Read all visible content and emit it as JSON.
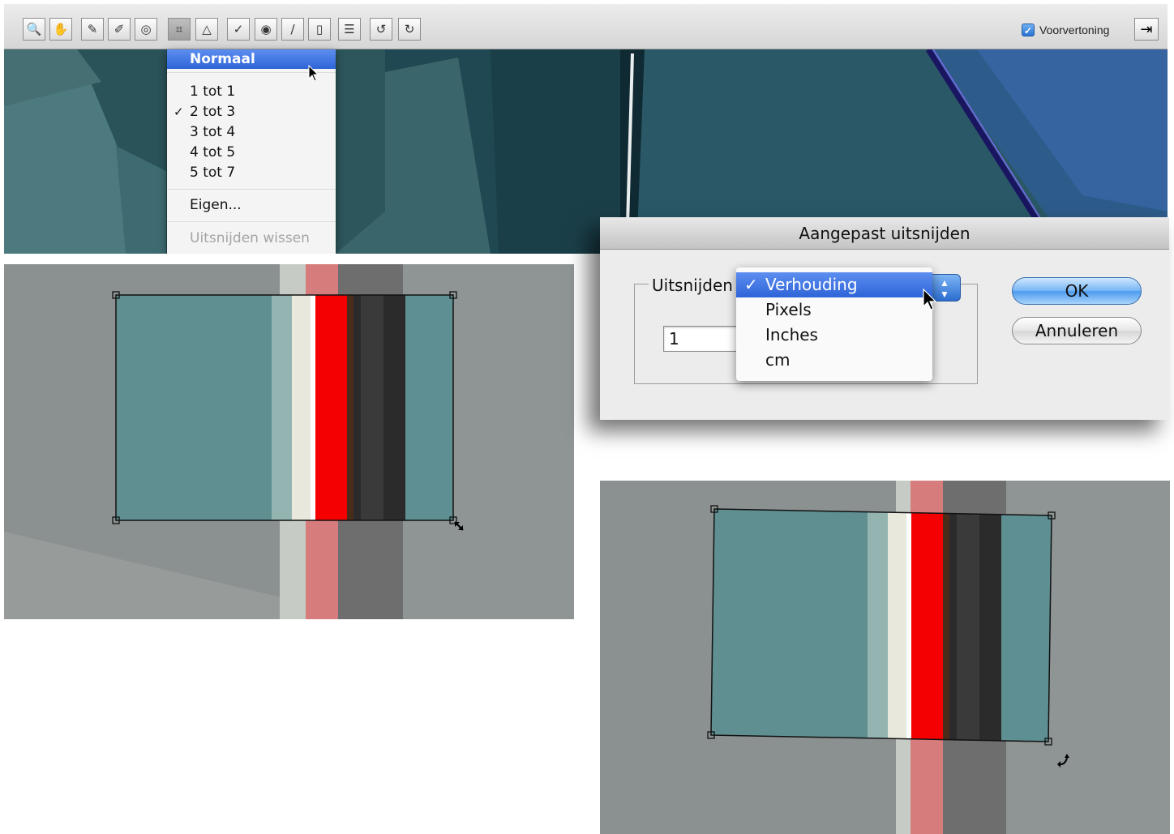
{
  "toolbar": {
    "tools": [
      {
        "name": "zoom-tool",
        "icon": "magnifier-icon",
        "glyph": "🔍"
      },
      {
        "name": "hand-tool",
        "icon": "hand-icon",
        "glyph": "✋"
      },
      {
        "name": "white-balance-tool",
        "icon": "eyedropper-icon",
        "glyph": "✎"
      },
      {
        "name": "color-sampler-tool",
        "icon": "color-sampler-icon",
        "glyph": "✐"
      },
      {
        "name": "target-adjustment-tool",
        "icon": "target-adjustment-icon",
        "glyph": "◎"
      },
      {
        "name": "crop-tool",
        "icon": "crop-icon",
        "glyph": "⌗",
        "active": true
      },
      {
        "name": "straighten-tool",
        "icon": "straighten-icon",
        "glyph": "△"
      },
      {
        "name": "spot-removal-tool",
        "icon": "spot-removal-icon",
        "glyph": "✓"
      },
      {
        "name": "red-eye-tool",
        "icon": "red-eye-icon",
        "glyph": "◉"
      },
      {
        "name": "adjustment-brush-tool",
        "icon": "brush-icon",
        "glyph": "/"
      },
      {
        "name": "graduated-filter-tool",
        "icon": "graduated-filter-icon",
        "glyph": "▯"
      },
      {
        "name": "preferences-tool",
        "icon": "list-icon",
        "glyph": "☰"
      },
      {
        "name": "rotate-left-tool",
        "icon": "rotate-left-icon",
        "glyph": "↺"
      },
      {
        "name": "rotate-right-tool",
        "icon": "rotate-right-icon",
        "glyph": "↻"
      }
    ],
    "preview_checked": true,
    "preview_label": "Voorvertoning",
    "fullscreen_icon": "fullscreen-icon"
  },
  "crop_menu": {
    "highlighted": "Normaal",
    "ratio_items": [
      {
        "label": "1 tot 1",
        "checked": false
      },
      {
        "label": "2 tot 3",
        "checked": true
      },
      {
        "label": "3 tot 4",
        "checked": false
      },
      {
        "label": "4 tot 5",
        "checked": false
      },
      {
        "label": "5 tot 7",
        "checked": false
      }
    ],
    "custom": "Eigen...",
    "clear": "Uitsnijden wissen"
  },
  "dialog": {
    "title": "Aangepast uitsnijden",
    "group_label": "Uitsnijden",
    "ratio_value": "1",
    "unit_options": [
      {
        "label": "Verhouding",
        "checked": true
      },
      {
        "label": "Pixels",
        "checked": false
      },
      {
        "label": "Inches",
        "checked": false
      },
      {
        "label": "cm",
        "checked": false
      }
    ],
    "ok_label": "OK",
    "cancel_label": "Annuleren"
  },
  "colors": {
    "photo_teal": "#5f8f92",
    "photo_dark_teal": "#1e4750",
    "photo_gray": "#8e9493",
    "clipping_red": "#f50000",
    "menu_highlight": "#3b6fe0"
  }
}
